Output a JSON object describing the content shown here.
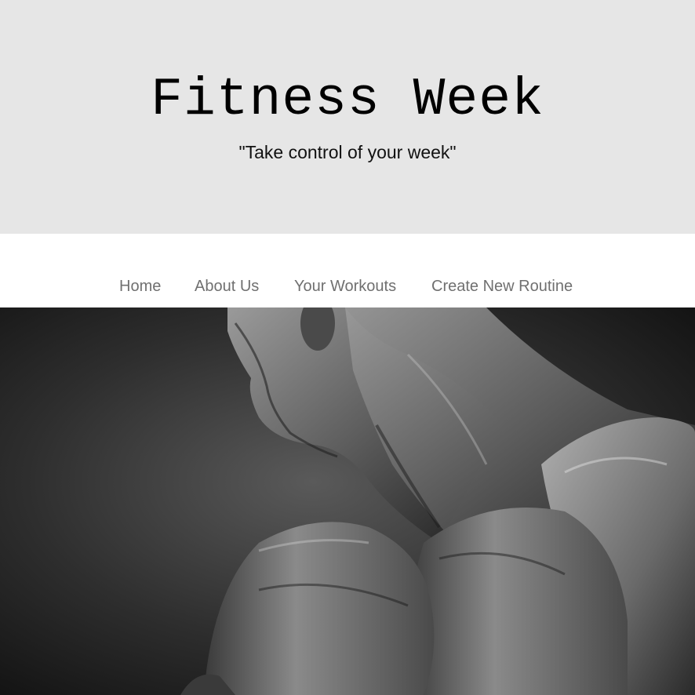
{
  "header": {
    "title": "Fitness Week",
    "tagline": "\"Take control of your week\""
  },
  "nav": {
    "items": [
      {
        "label": "Home"
      },
      {
        "label": "About Us"
      },
      {
        "label": "Your Workouts"
      },
      {
        "label": "Create New Routine"
      }
    ]
  },
  "hero": {
    "image": "black-and-white photo of muscular man flexing shoulder"
  },
  "colors": {
    "header_bg": "#e6e6e6",
    "nav_text": "#707070",
    "title_text": "#000000"
  }
}
